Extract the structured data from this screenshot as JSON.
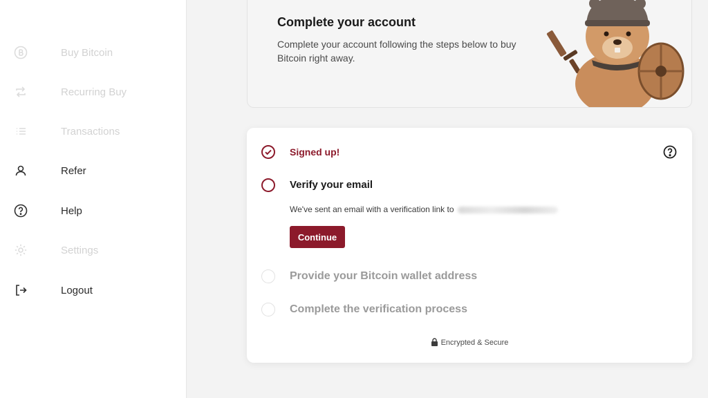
{
  "sidebar": {
    "items": [
      {
        "label": "Buy Bitcoin",
        "icon": "bitcoin-icon",
        "state": "disabled"
      },
      {
        "label": "Recurring Buy",
        "icon": "repeat-icon",
        "state": "disabled"
      },
      {
        "label": "Transactions",
        "icon": "list-icon",
        "state": "disabled"
      },
      {
        "label": "Refer",
        "icon": "user-icon",
        "state": "active"
      },
      {
        "label": "Help",
        "icon": "question-circle-icon",
        "state": "active"
      },
      {
        "label": "Settings",
        "icon": "gear-icon",
        "state": "disabled"
      },
      {
        "label": "Logout",
        "icon": "logout-icon",
        "state": "active"
      }
    ]
  },
  "banner": {
    "title": "Complete your account",
    "description": "Complete your account following the steps below to buy Bitcoin right away."
  },
  "steps": {
    "signed_up": "Signed up!",
    "verify_email": "Verify your email",
    "verify_message": "We've sent an email with a verification link to",
    "continue_label": "Continue",
    "wallet_address": "Provide your Bitcoin wallet address",
    "verification_process": "Complete the verification process"
  },
  "footer": {
    "secure_label": "Encrypted & Secure"
  },
  "colors": {
    "accent": "#8c1a2b",
    "background": "#f4f4f4",
    "card": "#ffffff"
  }
}
